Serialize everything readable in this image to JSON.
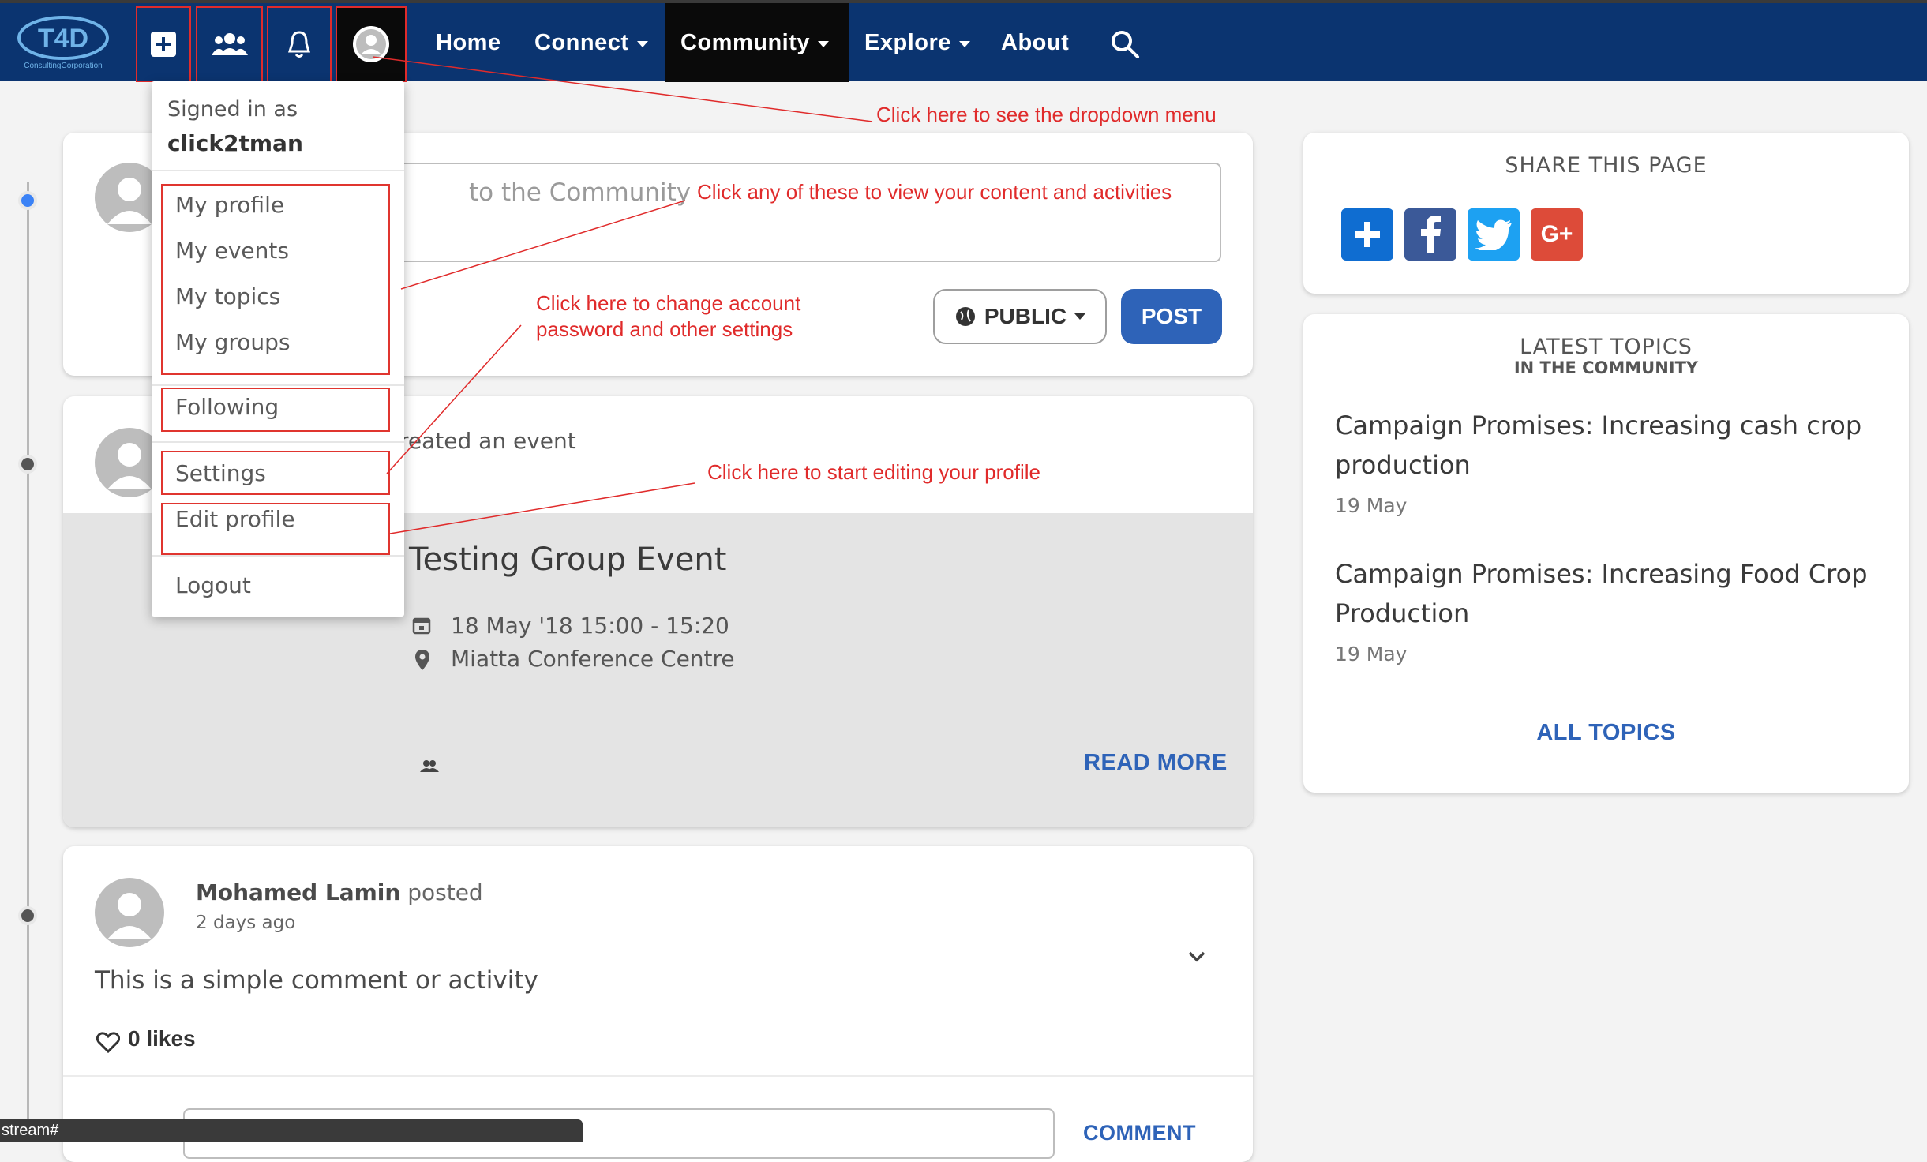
{
  "nav": {
    "logo_text": "T4D",
    "logo_subtext": "ConsultingCorporation",
    "links": {
      "home": "Home",
      "connect": "Connect",
      "community": "Community",
      "explore": "Explore",
      "about": "About"
    }
  },
  "dropdown": {
    "signed_in_label": "Signed in as",
    "username": "click2tman",
    "items": {
      "my_profile": "My profile",
      "my_events": "My events",
      "my_topics": "My topics",
      "my_groups": "My groups",
      "following": "Following",
      "settings": "Settings",
      "edit_profile": "Edit profile",
      "logout": "Logout"
    }
  },
  "annotations": {
    "dropdown_menu": "Click here to see the dropdown menu",
    "content": "Click any of these to view your content and activities",
    "settings_line1": "Click here to change account",
    "settings_line2": "password and other settings",
    "edit_profile": "Click here to start editing your profile"
  },
  "composer": {
    "placeholder_visible": "to the Community",
    "visibility": "PUBLIC",
    "post_label": "POST"
  },
  "event_post": {
    "action_visible": "reated an event",
    "title": "Testing Group Event",
    "date": "18 May '18 15:00 - 15:20",
    "location": "Miatta Conference Centre",
    "read_more": "READ MORE"
  },
  "activity_post": {
    "author": "Mohamed Lamin",
    "action": "posted",
    "time": "2 days ago",
    "body": "This is a simple comment or activity",
    "likes": "0 likes",
    "comment_label": "COMMENT"
  },
  "share": {
    "title": "SHARE THIS PAGE",
    "google_label": "G+"
  },
  "latest": {
    "title": "LATEST TOPICS",
    "subtitle": "IN THE COMMUNITY",
    "topics": [
      {
        "title_line1": "Campaign Promises: Increasing cash crop",
        "title_line2": "production",
        "date": "19 May"
      },
      {
        "title_line1": "Campaign Promises: Increasing Food Crop",
        "title_line2": "Production",
        "date": "19 May"
      }
    ],
    "all_topics": "ALL TOPICS"
  },
  "status_bar": {
    "url_text": "stream#"
  },
  "colors": {
    "navbar": "#0b3470",
    "accent": "#2e63b8",
    "annotation": "#e02b2b",
    "timeline_active": "#3b82f6"
  }
}
